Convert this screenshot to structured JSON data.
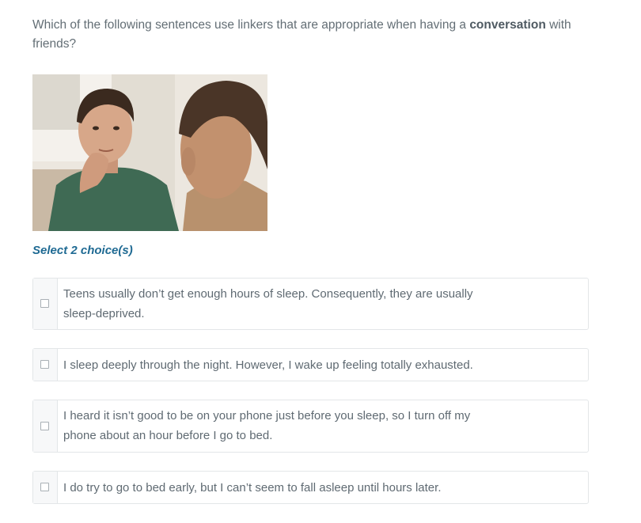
{
  "question": {
    "prefix": "Which of the following sentences use linkers that are appropriate when having a",
    "bold": "conversation",
    "suffix": "with friends?"
  },
  "image": {
    "alt": "Two men having a conversation"
  },
  "instruction": "Select 2 choice(s)",
  "choices": [
    {
      "text": "Teens usually don’t get enough hours of sleep. Consequently, they are usually sleep-deprived.",
      "checked": false
    },
    {
      "text": "I sleep deeply through the night. However, I wake up feeling totally exhausted.",
      "checked": false
    },
    {
      "text": "I heard it isn’t good to be on your phone just before you sleep, so I turn off my phone about an hour before I go to bed.",
      "checked": false
    },
    {
      "text": "I do try to go to bed early, but I can’t seem to fall asleep until hours later.",
      "checked": false
    }
  ],
  "colors": {
    "instruction": "#1f6a93",
    "border": "#e3e6e8",
    "text": "#5f6a72"
  }
}
